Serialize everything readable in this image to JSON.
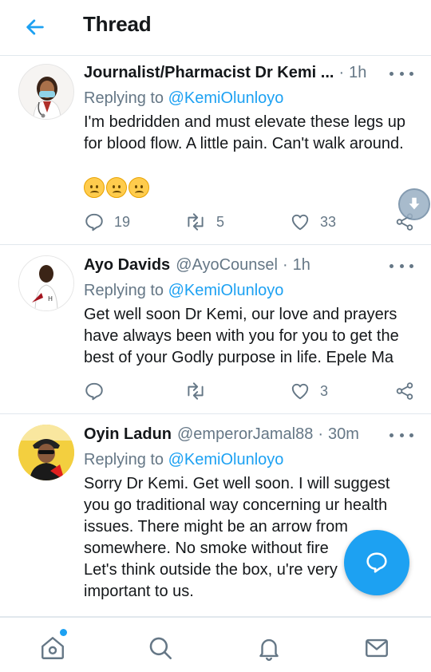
{
  "header": {
    "title": "Thread"
  },
  "tweets": [
    {
      "name": "Journalist/Pharmacist Dr Kemi ...",
      "handle": "",
      "time": "1h",
      "reply_label": "Replying to",
      "reply_to": "@KemiOlunloyo",
      "text": "I'm bedridden and must elevate these legs up for blood flow. A little pain. Can't walk around.",
      "emojis": [
        "frowning-face",
        "frowning-face",
        "frowning-face"
      ],
      "replies": "19",
      "retweets": "5",
      "likes": "33"
    },
    {
      "name": "Ayo Davids",
      "handle": "@AyoCounsel",
      "time": "1h",
      "reply_label": "Replying to",
      "reply_to": "@KemiOlunloyo",
      "text": "Get well soon Dr Kemi, our love and prayers have always been with you for you to get the best of your Godly purpose in life. Epele Ma",
      "replies": "",
      "retweets": "",
      "likes": "3"
    },
    {
      "name": "Oyin Ladun",
      "handle": "@emperorJamal88",
      "time": "30m",
      "reply_label": "Replying to",
      "reply_to": "@KemiOlunloyo",
      "text_lines": [
        "Sorry Dr Kemi. Get well soon. I will suggest",
        "you go traditional way concerning ur health",
        "issues. There might be an arrow from",
        "somewhere. No smoke without fire",
        "Let's think outside the box, u're very",
        "important to us."
      ]
    }
  ],
  "icons": {
    "back": "arrow-left-icon",
    "more": "more-icon",
    "reply": "reply-icon",
    "retweet": "retweet-icon",
    "like": "heart-icon",
    "share": "share-icon",
    "download": "download-icon",
    "compose": "compose-reply-icon",
    "home": "home-icon",
    "search": "search-icon",
    "notifications": "bell-icon",
    "messages": "mail-icon"
  },
  "colors": {
    "accent": "#1da1f2",
    "text": "#14171a",
    "muted": "#657786",
    "divider": "#e1e8ed"
  }
}
